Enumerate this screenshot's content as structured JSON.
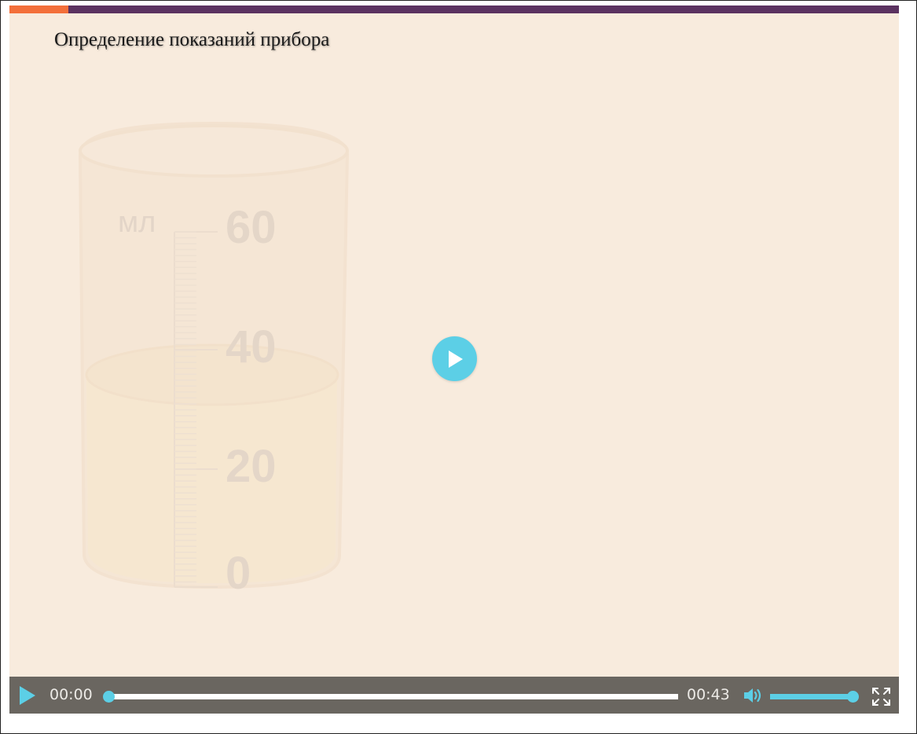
{
  "video": {
    "title": "Определение показаний прибора",
    "current_time": "00:00",
    "duration": "00:43",
    "progress_fraction": 0.0,
    "lesson_progress_fraction": 0.066,
    "volume_fraction": 1.0
  },
  "illustration": {
    "unit_label": "мл",
    "scale_labels": [
      "60",
      "40",
      "20",
      "0"
    ]
  },
  "colors": {
    "accent": "#5ccfe6",
    "background": "#f8ebdd",
    "top_bar": "#5b3260",
    "top_bar_progress": "#f36f3a",
    "control_bar": "#6a6660"
  },
  "icons": {
    "big_play": "play-icon",
    "control_play": "play-icon",
    "volume": "volume-icon",
    "fullscreen": "fullscreen-icon"
  }
}
